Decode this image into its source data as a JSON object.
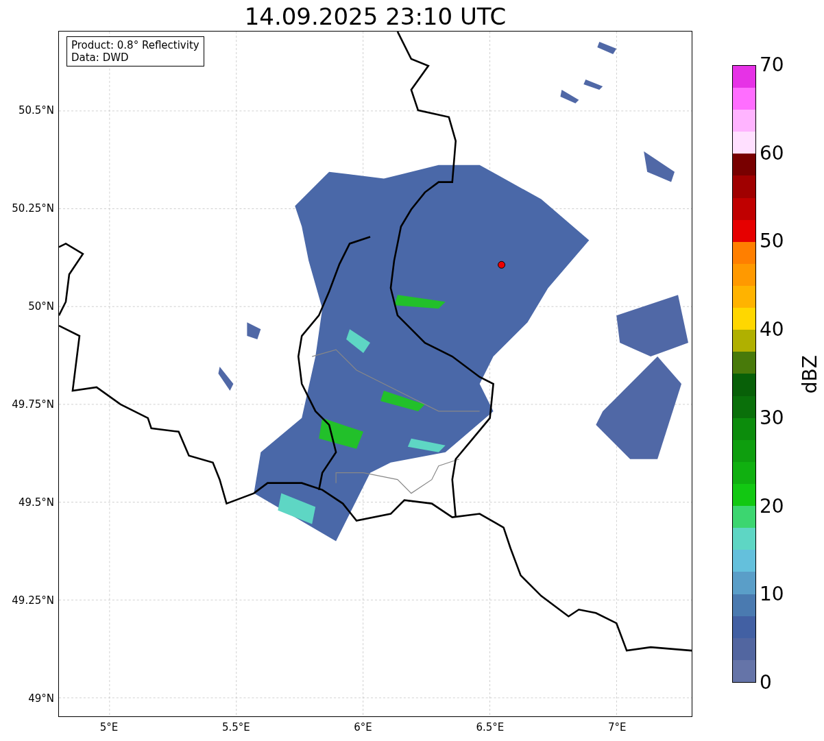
{
  "title": "14.09.2025 23:10 UTC",
  "legend": {
    "lines": [
      "Product: 0.8° Reflectivity",
      "Data: DWD"
    ]
  },
  "latitude_labels": [
    "50.5°N",
    "50.25°N",
    "50°N",
    "49.75°N",
    "49.5°N",
    "49.25°N",
    "49°N"
  ],
  "longitude_labels": [
    "5°E",
    "5.5°E",
    "6°E",
    "6.5°E",
    "7°E"
  ],
  "colorbar": {
    "label": "dBZ",
    "ticks": [
      "70",
      "60",
      "50",
      "40",
      "30",
      "20",
      "10",
      "0"
    ],
    "bands": [
      {
        "color": "#6574a8"
      },
      {
        "color": "#5266a0"
      },
      {
        "color": "#4260a3"
      },
      {
        "color": "#4a7ab0"
      },
      {
        "color": "#5a9ec8"
      },
      {
        "color": "#64c0dc"
      },
      {
        "color": "#5ed6c4"
      },
      {
        "color": "#3cd670"
      },
      {
        "color": "#12c812"
      },
      {
        "color": "#10b010"
      },
      {
        "color": "#0e9e0e"
      },
      {
        "color": "#0c8c0c"
      },
      {
        "color": "#0a700a"
      },
      {
        "color": "#086008"
      },
      {
        "color": "#487a0a"
      },
      {
        "color": "#b0b000"
      },
      {
        "color": "#ffd700"
      },
      {
        "color": "#ffb300"
      },
      {
        "color": "#ff9900"
      },
      {
        "color": "#ff7f00"
      },
      {
        "color": "#e60000"
      },
      {
        "color": "#c00000"
      },
      {
        "color": "#a00000"
      },
      {
        "color": "#780000"
      },
      {
        "color": "#ffe0ff"
      },
      {
        "color": "#ffb4ff"
      },
      {
        "color": "#ff6eff"
      },
      {
        "color": "#e632e6"
      }
    ]
  }
}
